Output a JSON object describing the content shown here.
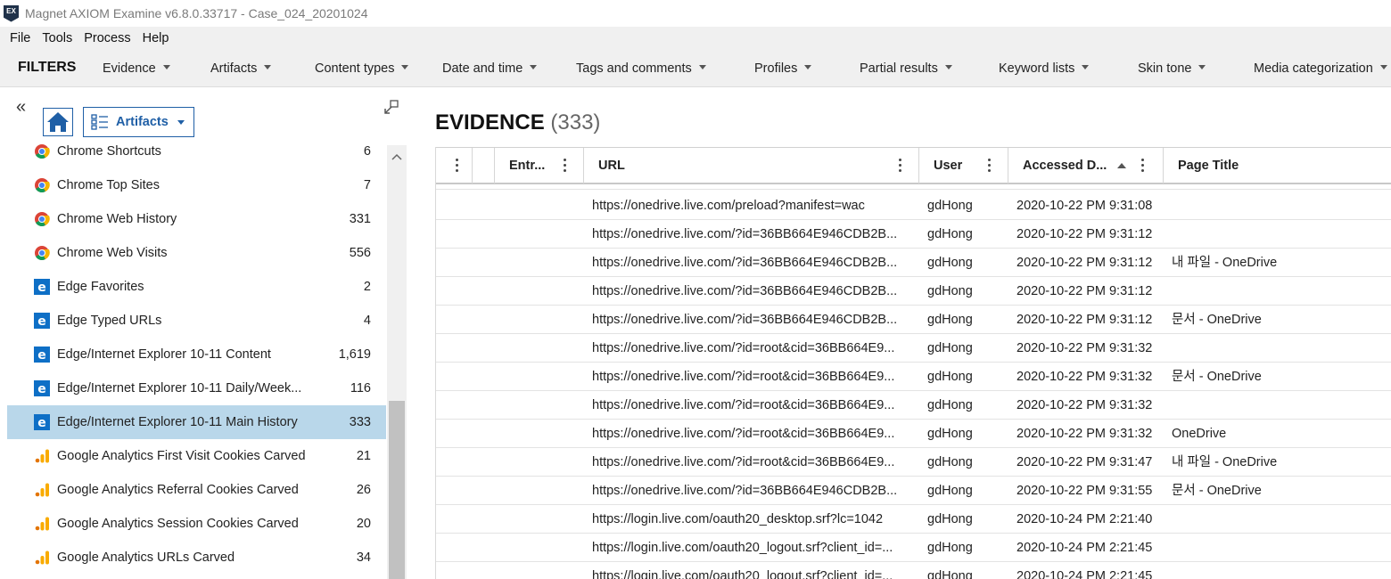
{
  "window": {
    "app_icon_text": "EX",
    "title": "Magnet AXIOM Examine v6.8.0.33717 - Case_024_20201024"
  },
  "menu": [
    "File",
    "Tools",
    "Process",
    "Help"
  ],
  "filters": {
    "title": "FILTERS",
    "items": [
      "Evidence",
      "Artifacts",
      "Content types",
      "Date and time",
      "Tags and comments",
      "Profiles",
      "Partial results",
      "Keyword lists",
      "Skin tone",
      "Media categorization"
    ]
  },
  "left_panel": {
    "collapse_glyph": "«",
    "view_selector": "Artifacts",
    "artifacts": [
      {
        "name": "Chrome Shortcuts",
        "count": "6",
        "icon": "chrome-icon"
      },
      {
        "name": "Chrome Top Sites",
        "count": "7",
        "icon": "chrome-icon"
      },
      {
        "name": "Chrome Web History",
        "count": "331",
        "icon": "chrome-icon"
      },
      {
        "name": "Chrome Web Visits",
        "count": "556",
        "icon": "chrome-icon"
      },
      {
        "name": "Edge Favorites",
        "count": "2",
        "icon": "edge-icon"
      },
      {
        "name": "Edge Typed URLs",
        "count": "4",
        "icon": "edge-icon"
      },
      {
        "name": "Edge/Internet Explorer 10-11 Content",
        "count": "1,619",
        "icon": "edge-icon"
      },
      {
        "name": "Edge/Internet Explorer 10-11 Daily/Week...",
        "count": "116",
        "icon": "edge-icon"
      },
      {
        "name": "Edge/Internet Explorer 10-11 Main History",
        "count": "333",
        "icon": "edge-icon",
        "selected": true
      },
      {
        "name": "Google Analytics First Visit Cookies Carved",
        "count": "21",
        "icon": "analytics-icon"
      },
      {
        "name": "Google Analytics Referral Cookies Carved",
        "count": "26",
        "icon": "analytics-icon"
      },
      {
        "name": "Google Analytics Session Cookies Carved",
        "count": "20",
        "icon": "analytics-icon"
      },
      {
        "name": "Google Analytics URLs Carved",
        "count": "34",
        "icon": "analytics-icon"
      }
    ]
  },
  "main": {
    "heading": "EVIDENCE",
    "heading_count": "(333)",
    "columns": {
      "entry": "Entr...",
      "url": "URL",
      "user": "User",
      "accessed": "Accessed D...",
      "title": "Page Title"
    },
    "rows": [
      {
        "url": "https://onedrive.live.com/preload?manifest=wac",
        "user": "gdHong",
        "date": "2020-10-22 PM 9:31:08",
        "title": ""
      },
      {
        "url": "https://onedrive.live.com/?id=36BB664E946CDB2B...",
        "user": "gdHong",
        "date": "2020-10-22 PM 9:31:12",
        "title": ""
      },
      {
        "url": "https://onedrive.live.com/?id=36BB664E946CDB2B...",
        "user": "gdHong",
        "date": "2020-10-22 PM 9:31:12",
        "title": "내 파일 - OneDrive"
      },
      {
        "url": "https://onedrive.live.com/?id=36BB664E946CDB2B...",
        "user": "gdHong",
        "date": "2020-10-22 PM 9:31:12",
        "title": ""
      },
      {
        "url": "https://onedrive.live.com/?id=36BB664E946CDB2B...",
        "user": "gdHong",
        "date": "2020-10-22 PM 9:31:12",
        "title": "문서 - OneDrive"
      },
      {
        "url": "https://onedrive.live.com/?id=root&cid=36BB664E9...",
        "user": "gdHong",
        "date": "2020-10-22 PM 9:31:32",
        "title": ""
      },
      {
        "url": "https://onedrive.live.com/?id=root&cid=36BB664E9...",
        "user": "gdHong",
        "date": "2020-10-22 PM 9:31:32",
        "title": "문서 - OneDrive"
      },
      {
        "url": "https://onedrive.live.com/?id=root&cid=36BB664E9...",
        "user": "gdHong",
        "date": "2020-10-22 PM 9:31:32",
        "title": ""
      },
      {
        "url": "https://onedrive.live.com/?id=root&cid=36BB664E9...",
        "user": "gdHong",
        "date": "2020-10-22 PM 9:31:32",
        "title": "OneDrive"
      },
      {
        "url": "https://onedrive.live.com/?id=root&cid=36BB664E9...",
        "user": "gdHong",
        "date": "2020-10-22 PM 9:31:47",
        "title": "내 파일 - OneDrive"
      },
      {
        "url": "https://onedrive.live.com/?id=36BB664E946CDB2B...",
        "user": "gdHong",
        "date": "2020-10-22 PM 9:31:55",
        "title": "문서 - OneDrive"
      },
      {
        "url": "https://login.live.com/oauth20_desktop.srf?lc=1042",
        "user": "gdHong",
        "date": "2020-10-24 PM 2:21:40",
        "title": ""
      },
      {
        "url": "https://login.live.com/oauth20_logout.srf?client_id=...",
        "user": "gdHong",
        "date": "2020-10-24 PM 2:21:45",
        "title": ""
      },
      {
        "url": "https://login.live.com/oauth20_logout.srf?client_id=...",
        "user": "gdHong",
        "date": "2020-10-24 PM 2:21:45",
        "title": ""
      }
    ]
  },
  "colors": {
    "accent": "#1f5fa6",
    "selected_row": "#b9d7ea",
    "toolbar_bg": "#f0f0f0"
  }
}
